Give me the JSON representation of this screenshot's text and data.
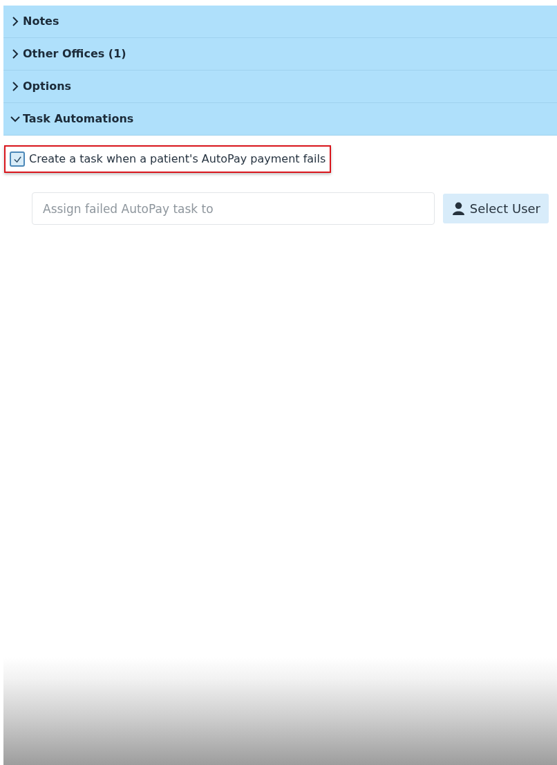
{
  "sections": [
    {
      "title": "Notes",
      "expanded": false
    },
    {
      "title": "Other Offices (1)",
      "expanded": false
    },
    {
      "title": "Options",
      "expanded": false
    },
    {
      "title": "Task Automations",
      "expanded": true
    }
  ],
  "task_automation": {
    "label": "Create a task when a patient's AutoPay payment fails",
    "checked": true,
    "highlighted": true,
    "assignee_field": {
      "placeholder": "Assign failed AutoPay task to"
    },
    "select_button": "Select User"
  }
}
